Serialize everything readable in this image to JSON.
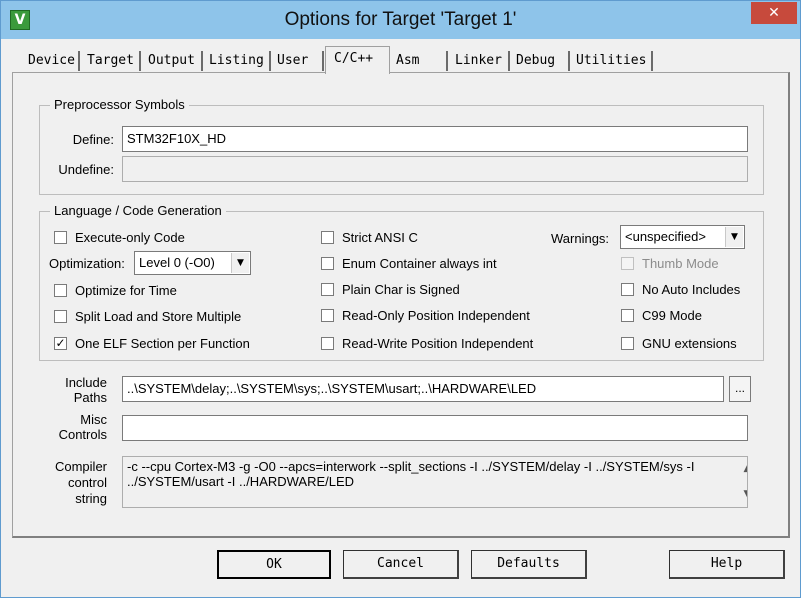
{
  "window": {
    "title": "Options for Target 'Target 1'",
    "app_icon": "keil-uvision-icon",
    "close_glyph": "✕"
  },
  "tabs": [
    {
      "label": "Device"
    },
    {
      "label": "Target"
    },
    {
      "label": "Output"
    },
    {
      "label": "Listing"
    },
    {
      "label": "User"
    },
    {
      "label": "C/C++"
    },
    {
      "label": "Asm"
    },
    {
      "label": "Linker"
    },
    {
      "label": "Debug"
    },
    {
      "label": "Utilities"
    }
  ],
  "active_tab": "C/C++",
  "preprocessor": {
    "legend": "Preprocessor Symbols",
    "define_label": "Define:",
    "define_value": "STM32F10X_HD",
    "undefine_label": "Undefine:",
    "undefine_value": ""
  },
  "codegen": {
    "legend": "Language / Code Generation",
    "execute_only": {
      "label": "Execute-only Code",
      "checked": false
    },
    "optimization_label": "Optimization:",
    "optimization_value": "Level 0 (-O0)",
    "optimize_time": {
      "label": "Optimize for Time",
      "checked": false
    },
    "split_load": {
      "label": "Split Load and Store Multiple",
      "checked": false
    },
    "one_elf": {
      "label": "One ELF Section per Function",
      "checked": true
    },
    "strict_ansi": {
      "label": "Strict ANSI C",
      "checked": false
    },
    "enum_container": {
      "label": "Enum Container always int",
      "checked": false
    },
    "plain_char": {
      "label": "Plain Char is Signed",
      "checked": false
    },
    "ro_pos": {
      "label": "Read-Only Position Independent",
      "checked": false
    },
    "rw_pos": {
      "label": "Read-Write Position Independent",
      "checked": false
    },
    "warnings_label": "Warnings:",
    "warnings_value": "<unspecified>",
    "thumb_mode": {
      "label": "Thumb Mode",
      "checked": false,
      "disabled": true
    },
    "no_auto_includes": {
      "label": "No Auto Includes",
      "checked": false
    },
    "c99_mode": {
      "label": "C99 Mode",
      "checked": false
    },
    "gnu_ext": {
      "label": "GNU extensions",
      "checked": false
    }
  },
  "include": {
    "label_line1": "Include",
    "label_line2": "Paths",
    "value": "..\\SYSTEM\\delay;..\\SYSTEM\\sys;..\\SYSTEM\\usart;..\\HARDWARE\\LED",
    "browse_label": "..."
  },
  "misc": {
    "label_line1": "Misc",
    "label_line2": "Controls",
    "value": ""
  },
  "compiler": {
    "label_line1": "Compiler",
    "label_line2": "control",
    "label_line3": "string",
    "line1": "-c --cpu Cortex-M3 -g -O0 --apcs=interwork --split_sections -I ../SYSTEM/delay -I ../SYSTEM/sys -I",
    "line2": "../SYSTEM/usart -I ../HARDWARE/LED"
  },
  "buttons": {
    "ok": "OK",
    "cancel": "Cancel",
    "defaults": "Defaults",
    "help": "Help"
  },
  "glyphs": {
    "check": "✓",
    "dropdown": "▼",
    "scroll_up": "▲",
    "scroll_down": "▼"
  }
}
